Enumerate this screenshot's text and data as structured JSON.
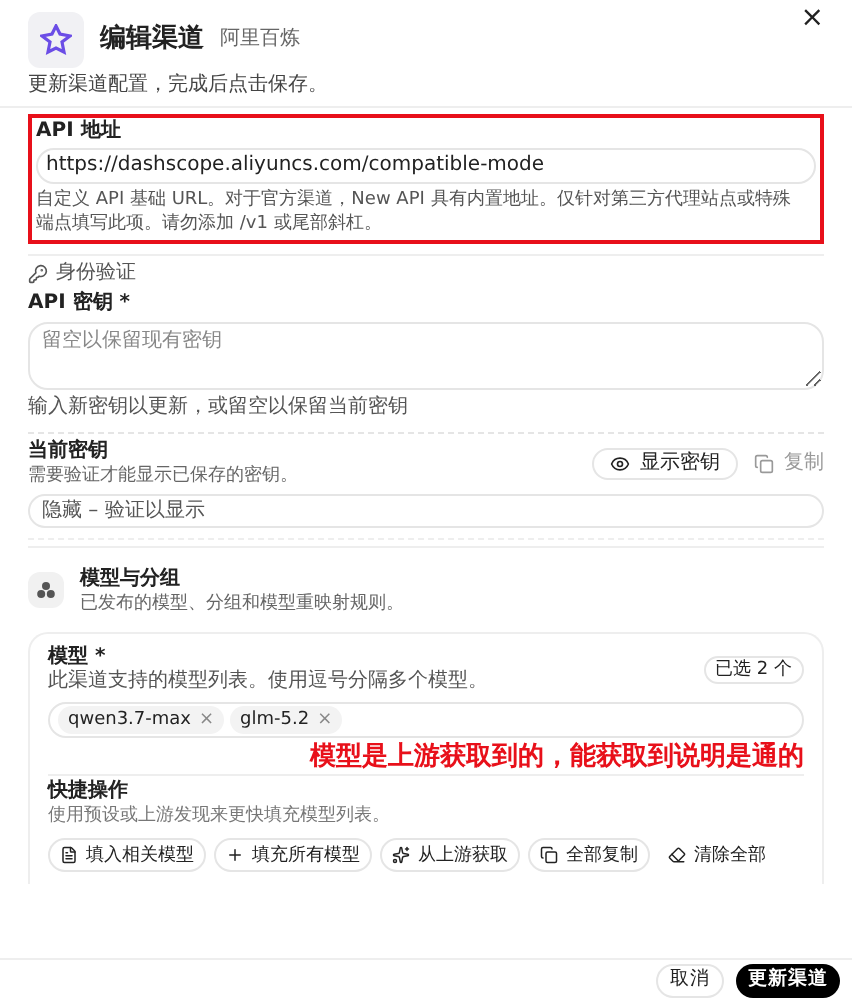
{
  "header": {
    "title": "编辑渠道",
    "subtitle": "阿里百炼",
    "description": "更新渠道配置，完成后点击保存。",
    "close": "×"
  },
  "api_address": {
    "label": "API 地址",
    "value": "https://dashscope.aliyuncs.com/compatible-mode",
    "help": "自定义 API 基础 URL。对于官方渠道，New API 具有内置地址。仅针对第三方代理站点或特殊端点填写此项。请勿添加 /v1 或尾部斜杠。"
  },
  "auth": {
    "section": "身份验证",
    "key_label": "API 密钥 *",
    "key_placeholder": "留空以保留现有密钥",
    "key_help": "输入新密钥以更新，或留空以保留当前密钥"
  },
  "current_key": {
    "label": "当前密钥",
    "help": "需要验证才能显示已保存的密钥。",
    "show_button": "显示密钥",
    "copy_button": "复制",
    "value": "隐藏 – 验证以显示"
  },
  "models_section": {
    "title": "模型与分组",
    "description": "已发布的模型、分组和模型重映射规则。"
  },
  "models": {
    "label": "模型 *",
    "help": "此渠道支持的模型列表。使用逗号分隔多个模型。",
    "count_badge": "已选 2 个",
    "tags": [
      "qwen3.7-max",
      "glm-5.2"
    ],
    "tag_remove": "×"
  },
  "quick_actions": {
    "title": "快捷操作",
    "help": "使用预设或上游发现来更快填充模型列表。",
    "buttons": [
      {
        "label": "填入相关模型",
        "kind": "file"
      },
      {
        "label": "填充所有模型",
        "kind": "plus"
      },
      {
        "label": "从上游获取",
        "kind": "sparkle"
      },
      {
        "label": "全部复制",
        "kind": "copy"
      },
      {
        "label": "清除全部",
        "kind": "eraser"
      }
    ]
  },
  "annotation": {
    "text": "模型是上游获取到的，能获取到说明是通的"
  },
  "footer": {
    "cancel": "取消",
    "submit": "更新渠道"
  }
}
